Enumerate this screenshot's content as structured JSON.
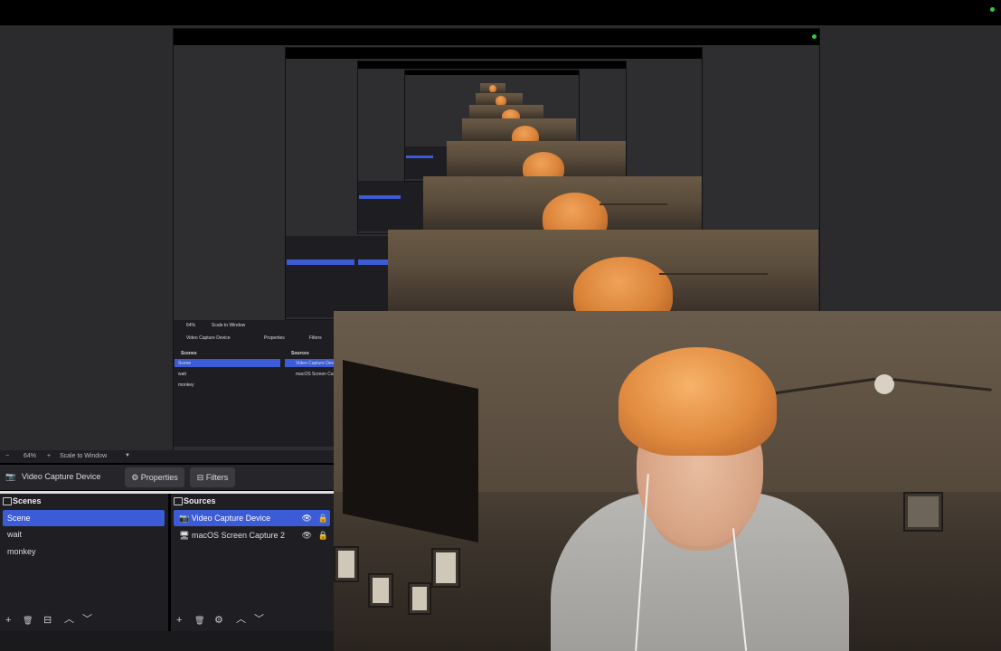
{
  "zoom": {
    "minus": "−",
    "value": "64%",
    "plus": "+",
    "mode": "Scale to Window",
    "arrow": "▼"
  },
  "source_toolbar": {
    "device_name": "Video Capture Device",
    "properties_label": "Properties",
    "filters_label": "Filters"
  },
  "scenes": {
    "title": "Scenes",
    "items": [
      {
        "label": "Scene"
      },
      {
        "label": "wait"
      },
      {
        "label": "monkey"
      }
    ]
  },
  "sources": {
    "title": "Sources",
    "items": [
      {
        "label": "Video Capture Device"
      },
      {
        "label": "macOS Screen Capture 2"
      }
    ]
  },
  "icons": {
    "add": "+",
    "remove": "🗑",
    "filter": "⊟",
    "up": "︿",
    "down": "﹀",
    "gear": "⚙",
    "eye": "👁",
    "lock": "🔒",
    "camera": "📷",
    "monitor": "🖥"
  },
  "mini": {
    "device": "Video Capture Device",
    "properties": "Properties",
    "filters": "Filters",
    "scenes": "Scenes",
    "sources": "Sources",
    "scene": "Scene",
    "wait": "wait",
    "monkey": "monkey",
    "src1": "Video Capture Dev",
    "src2": "macOS Screen Cap",
    "zoom": "64%",
    "mode": "Scale to Window"
  },
  "colors": {
    "accent": "#3c5bd6",
    "status": "#2ecc40",
    "panel": "#1f1f23"
  }
}
